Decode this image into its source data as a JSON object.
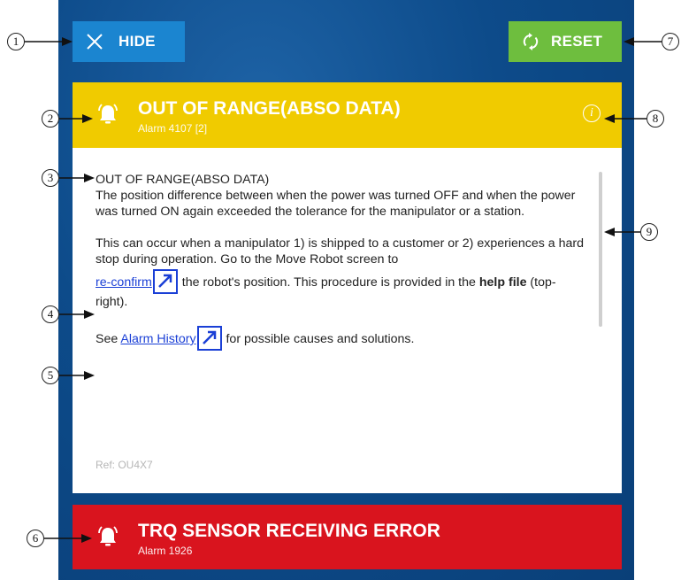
{
  "toolbar": {
    "hide_label": "HIDE",
    "reset_label": "RESET"
  },
  "alarm_active": {
    "title": "OUT OF RANGE(ABSO DATA)",
    "subtitle": "Alarm 4107 [2]",
    "color": "#f0cb00"
  },
  "message": {
    "heading": "OUT OF RANGE(ABSO DATA)",
    "para1": "The position difference between when the power was turned OFF and when the power was turned ON again exceeded the tolerance for the manipulator or a station.",
    "para2_a": "This can occur when a manipulator 1) is shipped to a customer or 2) experiences a hard stop during operation. Go to the Move Robot screen to",
    "reconfirm_link": "re-confirm",
    "para2_b": " the robot's position. This procedure is provided in the ",
    "help_bold": "help file",
    "para2_c": " (top-right).",
    "see_prefix": "See ",
    "history_link": "Alarm History",
    "see_suffix": " for possible causes and solutions.",
    "ref": "Ref: OU4X7"
  },
  "alarm_queued": {
    "title": "TRQ SENSOR RECEIVING ERROR",
    "subtitle": "Alarm 1926",
    "color": "#d9141e"
  },
  "callouts": [
    "1",
    "2",
    "3",
    "4",
    "5",
    "6",
    "7",
    "8",
    "9"
  ],
  "icons": {
    "hide": "close-icon",
    "reset": "refresh-icon",
    "alarm": "bell-icon",
    "info": "info-icon",
    "link": "external-link-icon"
  },
  "colors": {
    "hide_button": "#1b85d0",
    "reset_button": "#6ebe3e",
    "background": "#0d4b8a",
    "link": "#1a3fd6"
  }
}
